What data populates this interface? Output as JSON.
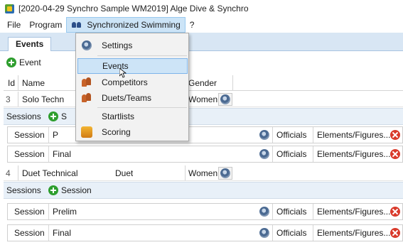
{
  "window": {
    "title": "[2020-04-29 Synchro Sample WM2019] Alge Dive & Synchro"
  },
  "menubar": {
    "items": [
      "File",
      "Program",
      "Synchronized Swimming",
      "?"
    ]
  },
  "tabs": [
    "Events"
  ],
  "toolbar": {
    "add_event": "Event"
  },
  "grid": {
    "headers": {
      "id": "Id",
      "name": "Name",
      "gender": "Gender"
    },
    "events": [
      {
        "id": "3",
        "name": "Solo Techn",
        "type": "",
        "gender": "Women"
      },
      {
        "id": "4",
        "name": "Duet Technical",
        "type": "Duet",
        "gender": "Women"
      }
    ],
    "sessions_label": "Sessions",
    "add_session_partial": "S",
    "add_session": "Session",
    "session_label": "Session",
    "sessions_event3": [
      {
        "name": "P"
      },
      {
        "name": "Final"
      }
    ],
    "sessions_event4": [
      {
        "name": "Prelim"
      },
      {
        "name": "Final"
      }
    ],
    "officials_label": "Officials",
    "elements_label": "Elements/Figures..."
  },
  "dropdown": {
    "items": [
      {
        "label": "Settings",
        "icon": "gear-icon"
      },
      {
        "label": "Events",
        "icon": "",
        "hover": true
      },
      {
        "label": "Competitors",
        "icon": "people-icon"
      },
      {
        "label": "Duets/Teams",
        "icon": "people-icon"
      },
      {
        "label": "Startlists",
        "icon": ""
      },
      {
        "label": "Scoring",
        "icon": "scoring-icon"
      }
    ]
  },
  "colors": {
    "tab_bg": "#d8e6f4",
    "menu_highlight": "#cce4f7",
    "add_green": "#2e9e2e",
    "delete_red": "#d93a2b"
  }
}
